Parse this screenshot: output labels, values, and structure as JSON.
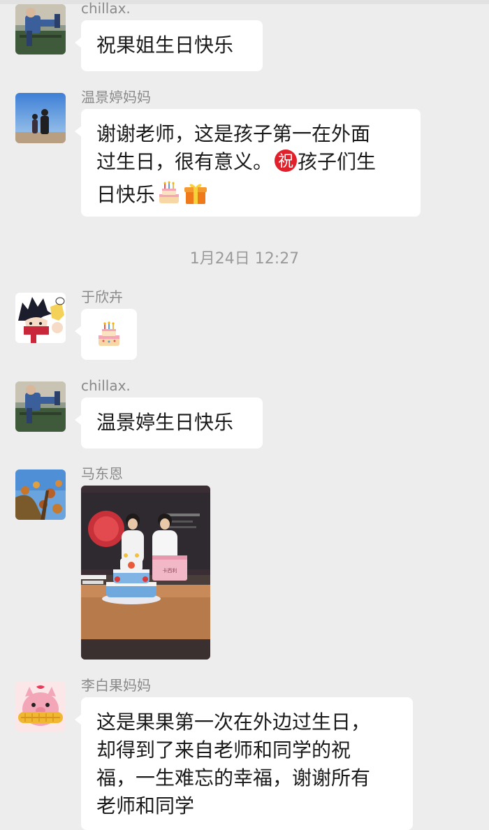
{
  "messages": [
    {
      "sender": "chillax.",
      "text_lines": [
        "祝果姐生日快乐"
      ]
    },
    {
      "sender": "温景婷妈妈",
      "text_lines": [
        "谢谢老师，这是孩子第一在外面",
        "过生日，很有意义。",
        "孩子们生",
        "日快乐"
      ],
      "emoji_badge": "祝"
    },
    {
      "sender": "于欣卉",
      "emoji": "birthday-cake-icon"
    },
    {
      "sender": "chillax.",
      "text_lines": [
        "温景婷生日快乐"
      ]
    },
    {
      "sender": "马东恩",
      "image": "birthday-party-photo",
      "photo_box_text": "卡西利"
    },
    {
      "sender": "李白果妈妈",
      "text_lines": [
        "这是果果第一次在外边过生日，",
        "却得到了来自老师和同学的祝",
        "福，一生难忘的幸福，谢谢所有",
        "老师和同学"
      ]
    }
  ],
  "timestamp": "1月24日 12:27",
  "colors": {
    "background": "#ededed",
    "bubble": "#ffffff",
    "name": "#8a8a8a",
    "text": "#1a1a1a"
  }
}
